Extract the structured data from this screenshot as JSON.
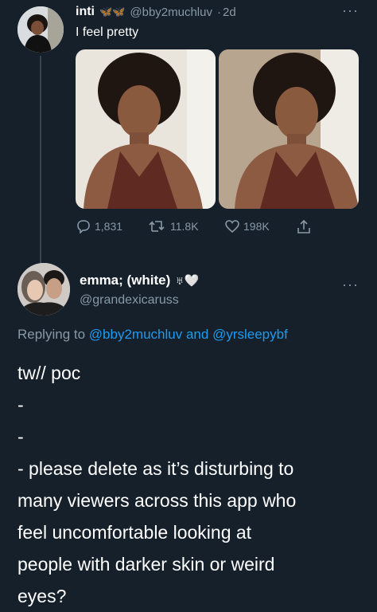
{
  "parent_tweet": {
    "display_name": "inti",
    "name_emojis": "🦋🦋",
    "handle": "@bby2muchluv",
    "separator": "·",
    "time": "2d",
    "text": "I feel pretty",
    "actions": {
      "replies": "1,831",
      "retweets": "11.8K",
      "likes": "198K"
    }
  },
  "reply_tweet": {
    "display_name": "emma; (white)",
    "name_suffix": "♅🤍",
    "handle": "@grandexicaruss",
    "replying_prefix": "Replying to",
    "replying_user1": "@bby2muchluv",
    "replying_and": "and",
    "replying_user2": "@yrsleepybf",
    "lines": [
      "tw// poc",
      "-",
      "-",
      "- please delete as it’s disturbing to",
      "many viewers across this app who",
      "feel uncomfortable looking at",
      "people with darker skin or weird",
      "eyes?"
    ]
  },
  "colors": {
    "background": "#15202b",
    "text": "#ffffff",
    "muted": "#8899a6",
    "link": "#1d9bf0"
  },
  "icons": [
    "more-icon",
    "reply-icon",
    "retweet-icon",
    "like-icon",
    "share-icon"
  ]
}
